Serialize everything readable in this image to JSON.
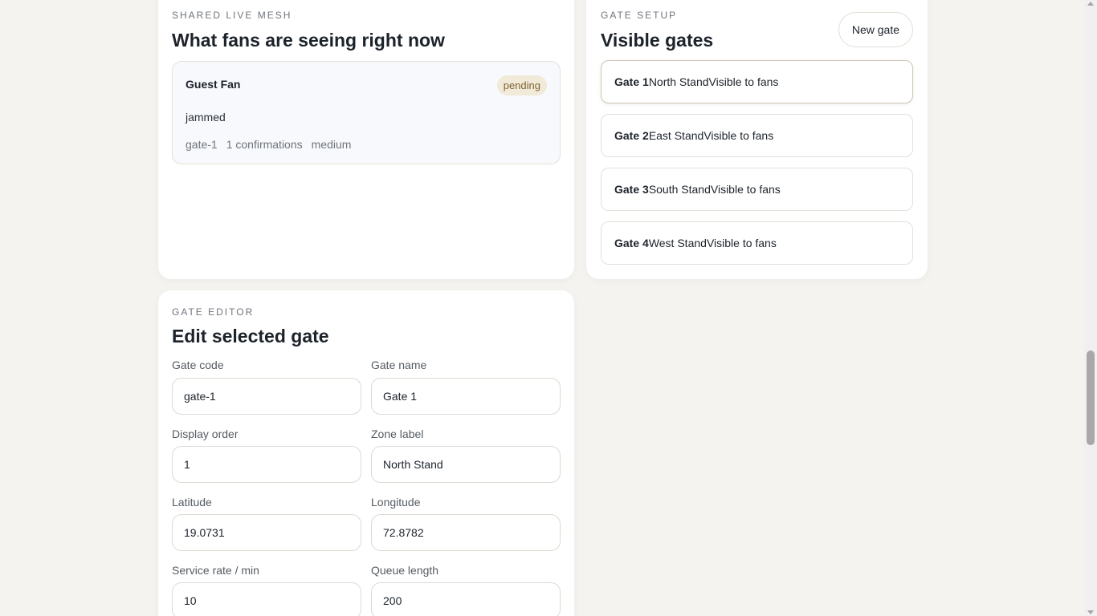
{
  "mesh": {
    "eyebrow": "SHARED LIVE MESH",
    "title": "What fans are seeing right now",
    "report": {
      "user": "Guest Fan",
      "status": "pending",
      "text": "jammed",
      "gate": "gate-1",
      "confirmations": "1 confirmations",
      "severity": "medium"
    }
  },
  "gates": {
    "eyebrow": "GATE SETUP",
    "title": "Visible gates",
    "new_label": "New gate",
    "items": [
      {
        "name": "Gate 1",
        "zone": "North Stand",
        "visibility": "Visible to fans"
      },
      {
        "name": "Gate 2",
        "zone": "East Stand",
        "visibility": "Visible to fans"
      },
      {
        "name": "Gate 3",
        "zone": "South Stand",
        "visibility": "Visible to fans"
      },
      {
        "name": "Gate 4",
        "zone": "West Stand",
        "visibility": "Visible to fans"
      }
    ]
  },
  "editor": {
    "eyebrow": "GATE EDITOR",
    "title": "Edit selected gate",
    "fields": {
      "gate_code": {
        "label": "Gate code",
        "value": "gate-1"
      },
      "gate_name": {
        "label": "Gate name",
        "value": "Gate 1"
      },
      "display_order": {
        "label": "Display order",
        "value": "1"
      },
      "zone_label": {
        "label": "Zone label",
        "value": "North Stand"
      },
      "latitude": {
        "label": "Latitude",
        "value": "19.0731"
      },
      "longitude": {
        "label": "Longitude",
        "value": "72.8782"
      },
      "service_rate": {
        "label": "Service rate / min",
        "value": "10"
      },
      "queue_length": {
        "label": "Queue length",
        "value": "200"
      }
    }
  },
  "colors": {
    "background": "#f4f3ef",
    "card": "#ffffff",
    "pending_badge_bg": "#f2ead8",
    "pending_badge_text": "#7b6433"
  }
}
